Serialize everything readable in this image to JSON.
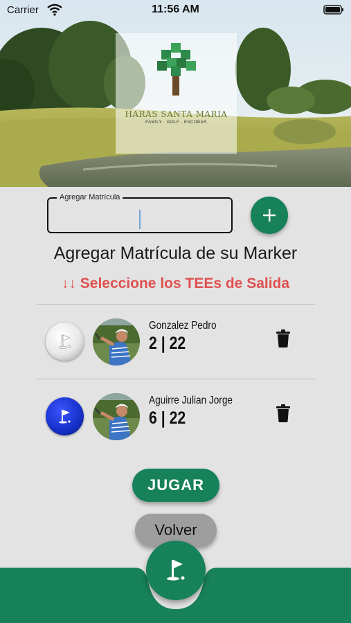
{
  "status_bar": {
    "carrier": "Carrier",
    "time": "11:56 AM"
  },
  "header": {
    "logo_name": "HARAS SANTA MARIA",
    "logo_sub": "FAMILY · GOLF · ESCOBAR"
  },
  "input": {
    "label": "Agregar Matrícula",
    "value": ""
  },
  "marker_title": "Agregar Matrícula de su Marker",
  "tee_prompt": "↓↓ Seleccione los TEEs de Salida",
  "players": [
    {
      "name": "Gonzalez Pedro",
      "score": "2 | 22",
      "tee": "white"
    },
    {
      "name": "Aguirre Julian Jorge",
      "score": "6 | 22",
      "tee": "blue"
    }
  ],
  "buttons": {
    "play": "JUGAR",
    "back": "Volver"
  },
  "colors": {
    "accent": "#17815a",
    "warning": "#e05050",
    "tee_white": "#e8e8e8",
    "tee_blue": "#1530c8"
  },
  "icons": {
    "add": "plus-icon",
    "delete": "trash-icon",
    "tee": "flag-icon",
    "home": "golf-flag-icon"
  }
}
